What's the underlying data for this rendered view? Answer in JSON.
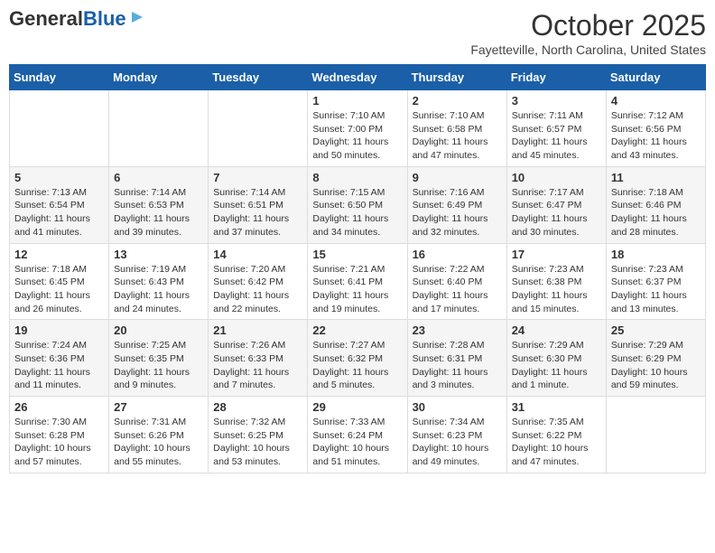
{
  "header": {
    "logo_general": "General",
    "logo_blue": "Blue",
    "month_year": "October 2025",
    "location": "Fayetteville, North Carolina, United States"
  },
  "weekdays": [
    "Sunday",
    "Monday",
    "Tuesday",
    "Wednesday",
    "Thursday",
    "Friday",
    "Saturday"
  ],
  "weeks": [
    [
      {
        "day": "",
        "content": ""
      },
      {
        "day": "",
        "content": ""
      },
      {
        "day": "",
        "content": ""
      },
      {
        "day": "1",
        "content": "Sunrise: 7:10 AM\nSunset: 7:00 PM\nDaylight: 11 hours\nand 50 minutes."
      },
      {
        "day": "2",
        "content": "Sunrise: 7:10 AM\nSunset: 6:58 PM\nDaylight: 11 hours\nand 47 minutes."
      },
      {
        "day": "3",
        "content": "Sunrise: 7:11 AM\nSunset: 6:57 PM\nDaylight: 11 hours\nand 45 minutes."
      },
      {
        "day": "4",
        "content": "Sunrise: 7:12 AM\nSunset: 6:56 PM\nDaylight: 11 hours\nand 43 minutes."
      }
    ],
    [
      {
        "day": "5",
        "content": "Sunrise: 7:13 AM\nSunset: 6:54 PM\nDaylight: 11 hours\nand 41 minutes."
      },
      {
        "day": "6",
        "content": "Sunrise: 7:14 AM\nSunset: 6:53 PM\nDaylight: 11 hours\nand 39 minutes."
      },
      {
        "day": "7",
        "content": "Sunrise: 7:14 AM\nSunset: 6:51 PM\nDaylight: 11 hours\nand 37 minutes."
      },
      {
        "day": "8",
        "content": "Sunrise: 7:15 AM\nSunset: 6:50 PM\nDaylight: 11 hours\nand 34 minutes."
      },
      {
        "day": "9",
        "content": "Sunrise: 7:16 AM\nSunset: 6:49 PM\nDaylight: 11 hours\nand 32 minutes."
      },
      {
        "day": "10",
        "content": "Sunrise: 7:17 AM\nSunset: 6:47 PM\nDaylight: 11 hours\nand 30 minutes."
      },
      {
        "day": "11",
        "content": "Sunrise: 7:18 AM\nSunset: 6:46 PM\nDaylight: 11 hours\nand 28 minutes."
      }
    ],
    [
      {
        "day": "12",
        "content": "Sunrise: 7:18 AM\nSunset: 6:45 PM\nDaylight: 11 hours\nand 26 minutes."
      },
      {
        "day": "13",
        "content": "Sunrise: 7:19 AM\nSunset: 6:43 PM\nDaylight: 11 hours\nand 24 minutes."
      },
      {
        "day": "14",
        "content": "Sunrise: 7:20 AM\nSunset: 6:42 PM\nDaylight: 11 hours\nand 22 minutes."
      },
      {
        "day": "15",
        "content": "Sunrise: 7:21 AM\nSunset: 6:41 PM\nDaylight: 11 hours\nand 19 minutes."
      },
      {
        "day": "16",
        "content": "Sunrise: 7:22 AM\nSunset: 6:40 PM\nDaylight: 11 hours\nand 17 minutes."
      },
      {
        "day": "17",
        "content": "Sunrise: 7:23 AM\nSunset: 6:38 PM\nDaylight: 11 hours\nand 15 minutes."
      },
      {
        "day": "18",
        "content": "Sunrise: 7:23 AM\nSunset: 6:37 PM\nDaylight: 11 hours\nand 13 minutes."
      }
    ],
    [
      {
        "day": "19",
        "content": "Sunrise: 7:24 AM\nSunset: 6:36 PM\nDaylight: 11 hours\nand 11 minutes."
      },
      {
        "day": "20",
        "content": "Sunrise: 7:25 AM\nSunset: 6:35 PM\nDaylight: 11 hours\nand 9 minutes."
      },
      {
        "day": "21",
        "content": "Sunrise: 7:26 AM\nSunset: 6:33 PM\nDaylight: 11 hours\nand 7 minutes."
      },
      {
        "day": "22",
        "content": "Sunrise: 7:27 AM\nSunset: 6:32 PM\nDaylight: 11 hours\nand 5 minutes."
      },
      {
        "day": "23",
        "content": "Sunrise: 7:28 AM\nSunset: 6:31 PM\nDaylight: 11 hours\nand 3 minutes."
      },
      {
        "day": "24",
        "content": "Sunrise: 7:29 AM\nSunset: 6:30 PM\nDaylight: 11 hours\nand 1 minute."
      },
      {
        "day": "25",
        "content": "Sunrise: 7:29 AM\nSunset: 6:29 PM\nDaylight: 10 hours\nand 59 minutes."
      }
    ],
    [
      {
        "day": "26",
        "content": "Sunrise: 7:30 AM\nSunset: 6:28 PM\nDaylight: 10 hours\nand 57 minutes."
      },
      {
        "day": "27",
        "content": "Sunrise: 7:31 AM\nSunset: 6:26 PM\nDaylight: 10 hours\nand 55 minutes."
      },
      {
        "day": "28",
        "content": "Sunrise: 7:32 AM\nSunset: 6:25 PM\nDaylight: 10 hours\nand 53 minutes."
      },
      {
        "day": "29",
        "content": "Sunrise: 7:33 AM\nSunset: 6:24 PM\nDaylight: 10 hours\nand 51 minutes."
      },
      {
        "day": "30",
        "content": "Sunrise: 7:34 AM\nSunset: 6:23 PM\nDaylight: 10 hours\nand 49 minutes."
      },
      {
        "day": "31",
        "content": "Sunrise: 7:35 AM\nSunset: 6:22 PM\nDaylight: 10 hours\nand 47 minutes."
      },
      {
        "day": "",
        "content": ""
      }
    ]
  ]
}
